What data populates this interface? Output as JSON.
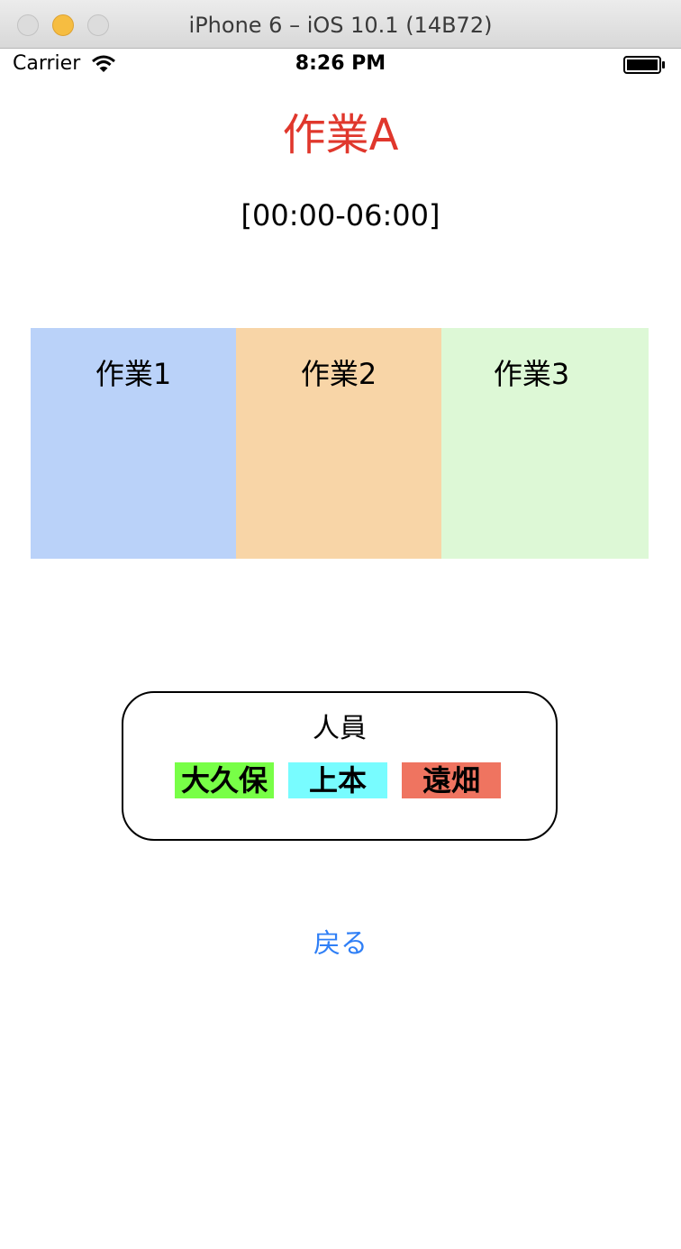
{
  "window": {
    "title": "iPhone 6 – iOS 10.1 (14B72)"
  },
  "status_bar": {
    "carrier": "Carrier",
    "time": "8:26 PM"
  },
  "screen": {
    "title": "作業A",
    "time_range": "[00:00-06:00]",
    "tasks": [
      {
        "label": "作業1",
        "color": "#bad2f9"
      },
      {
        "label": "作業2",
        "color": "#f8d5a7"
      },
      {
        "label": "作業3",
        "color": "#ddf8d6"
      }
    ],
    "personnel": {
      "title": "人員",
      "members": [
        {
          "name": "大久保",
          "color": "#78ff47"
        },
        {
          "name": "上本",
          "color": "#78fcff"
        },
        {
          "name": "遠畑",
          "color": "#ef7460"
        }
      ]
    },
    "back_label": "戻る"
  },
  "colors": {
    "title": "#e0372c",
    "link": "#2f7ff6"
  },
  "icons": [
    "close-button-icon",
    "minimize-button-icon",
    "zoom-button-icon",
    "wifi-icon",
    "battery-icon"
  ]
}
